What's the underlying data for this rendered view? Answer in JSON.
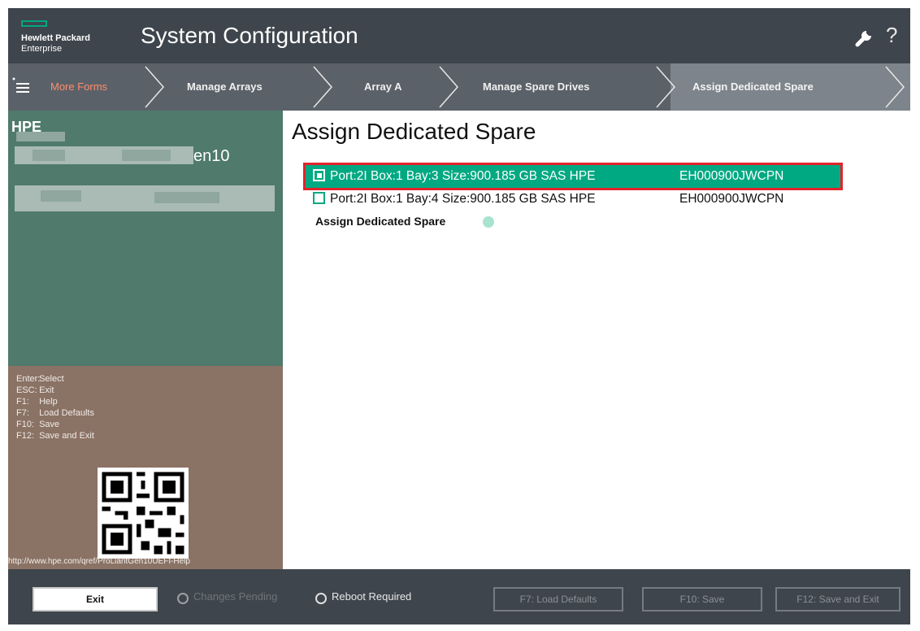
{
  "header": {
    "logo_line1": "Hewlett Packard",
    "logo_line2": "Enterprise",
    "title": "System Configuration",
    "wrench_icon": "wrench-icon",
    "help_icon": "?"
  },
  "breadcrumb": {
    "menu_icon": "hamburger-menu-icon",
    "items": [
      {
        "label": "More Forms"
      },
      {
        "label": "Manage Arrays"
      },
      {
        "label": "Array A"
      },
      {
        "label": "Manage Spare Drives"
      },
      {
        "label": "Assign Dedicated Spare"
      }
    ]
  },
  "system_info": {
    "brand": "HPE",
    "model_suffix": "en10"
  },
  "keys": [
    {
      "key": "Enter:",
      "action": "Select"
    },
    {
      "key": "ESC:",
      "action": "Exit"
    },
    {
      "key": "F1:",
      "action": "Help"
    },
    {
      "key": "F7:",
      "action": "Load Defaults"
    },
    {
      "key": "F10:",
      "action": "Save"
    },
    {
      "key": "F12:",
      "action": "Save and Exit"
    }
  ],
  "help_url": "http://www.hpe.com/qref/ProLiantGen10UEFI-Help",
  "main": {
    "title": "Assign Dedicated Spare",
    "drives": [
      {
        "label": "Port:2I Box:1 Bay:3 Size:900.185 GB SAS HPE",
        "model": "EH000900JWCPN",
        "checked": true
      },
      {
        "label": "Port:2I Box:1 Bay:4 Size:900.185 GB SAS HPE",
        "model": "EH000900JWCPN",
        "checked": false
      }
    ],
    "action": "Assign Dedicated Spare"
  },
  "footer": {
    "exit": "Exit",
    "changes_pending": "Changes Pending",
    "reboot_required": "Reboot Required",
    "load_defaults": "F7: Load Defaults",
    "save": "F10: Save",
    "save_exit": "F12: Save and Exit"
  },
  "colors": {
    "accent": "#01a982",
    "header_bg": "#3e454c",
    "breadcrumb_bg": "#5b6168",
    "system_panel": "#4f7a6c",
    "keys_panel": "#8a7265",
    "highlight_box": "#e3232b",
    "more_forms": "#ff8d6d"
  }
}
